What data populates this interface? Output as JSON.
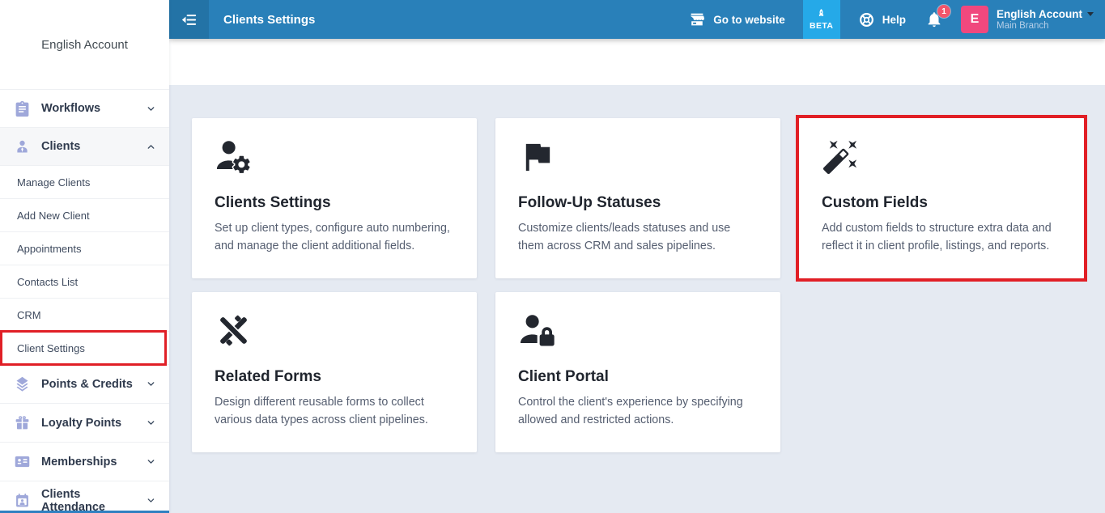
{
  "sidebar": {
    "account_name": "English Account",
    "menu_top": [
      {
        "label": "Workflows"
      },
      {
        "label": "Clients"
      }
    ],
    "submenu": [
      {
        "label": "Manage Clients"
      },
      {
        "label": "Add New Client"
      },
      {
        "label": "Appointments"
      },
      {
        "label": "Contacts List"
      },
      {
        "label": "CRM"
      },
      {
        "label": "Client Settings"
      }
    ],
    "menu_bottom": [
      {
        "label": "Points & Credits"
      },
      {
        "label": "Loyalty Points"
      },
      {
        "label": "Memberships"
      },
      {
        "label": "Clients Attendance"
      }
    ]
  },
  "topbar": {
    "title": "Clients Settings",
    "go_to_website": "Go to website",
    "beta": "BETA",
    "help": "Help",
    "notification_count": "1",
    "avatar_letter": "E",
    "account_name": "English Account",
    "branch": "Main Branch"
  },
  "cards": [
    {
      "title": "Clients Settings",
      "description": "Set up client types, configure auto numbering, and manage the client additional fields."
    },
    {
      "title": "Follow-Up Statuses",
      "description": "Customize clients/leads statuses and use them across CRM and sales pipelines."
    },
    {
      "title": "Custom Fields",
      "description": "Add custom fields to structure extra data and reflect it in client profile, listings, and reports."
    },
    {
      "title": "Related Forms",
      "description": "Design different reusable forms to collect various data types across client pipelines."
    },
    {
      "title": "Client Portal",
      "description": "Control the client's experience by specifying allowed and restricted actions."
    }
  ],
  "annotations": {
    "highlighted_sidebar_item": "Client Settings",
    "highlighted_card": "Custom Fields"
  },
  "colors": {
    "topbar_blue": "#2980b9",
    "toggle_blue": "#2373a6",
    "beta_blue": "#25a9e8",
    "avatar_pink": "#f0487e",
    "badge_red": "#f2566b",
    "annotation_red": "#e11f26",
    "sidebar_icon_periwinkle": "#9fa8da",
    "content_bg": "#e5eaf2"
  }
}
